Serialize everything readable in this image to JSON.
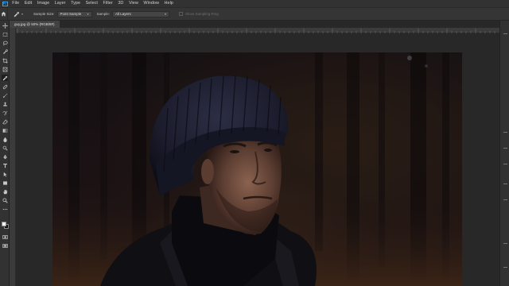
{
  "menubar": {
    "items": [
      "File",
      "Edit",
      "Image",
      "Layer",
      "Type",
      "Select",
      "Filter",
      "3D",
      "View",
      "Window",
      "Help"
    ]
  },
  "options": {
    "sample_size_label": "Sample Size:",
    "sample_size_value": "Point Sample",
    "sample_label": "Sample:",
    "sample_value": "All Layers",
    "show_ring_label": "Show Sampling Ring"
  },
  "document": {
    "tab_title": "guy.jpg @ 50% (RGB/8#)"
  },
  "icons": {
    "app": "photoshop-logo",
    "home": "home-icon",
    "active_tool": "eyedropper-icon"
  },
  "colors": {
    "accent": "#31a8ff",
    "foreground": "#f0f0f0",
    "background": "#111111"
  }
}
